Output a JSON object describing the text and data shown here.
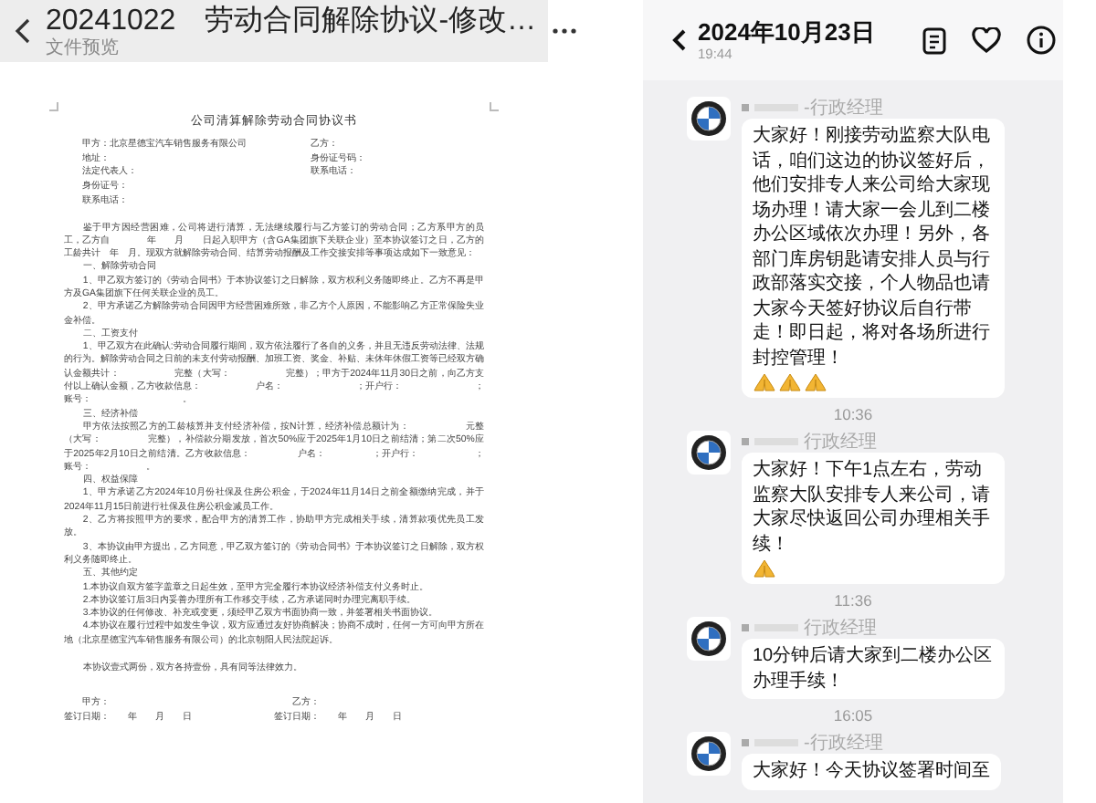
{
  "left": {
    "header": {
      "title": "20241022　劳动合同解除协议-修改…",
      "subtitle": "文件预览"
    },
    "document": {
      "title": "公司清算解除劳动合同协议书",
      "parties": [
        {
          "left": "甲方：北京星德宝汽车销售服务有限公司",
          "right": "乙方："
        },
        {
          "left": "地址：",
          "right": "身份证号码："
        },
        {
          "left": "法定代表人：",
          "right": "联系电话："
        },
        {
          "left": "身份证号："
        },
        {
          "left": "联系电话："
        }
      ],
      "blocks": [
        {
          "kind": "para",
          "text": "鉴于甲方因经营困难，公司将进行清算，无法继续履行与乙方签订的劳动合同；乙方系甲方的员工，乙方自　　　　年　　月　　日起入职甲方（含GA集团旗下关联企业）至本协议签订之日，乙方的工龄共计　年　月。现双方就解除劳动合同、结算劳动报酬及工作交接安排等事项达成如下一致意见："
        },
        {
          "kind": "heading",
          "text": "一、解除劳动合同"
        },
        {
          "kind": "para",
          "text": "1、甲乙双方签订的《劳动合同书》于本协议签订之日解除，双方权利义务随即终止。乙方不再是甲方及GA集团旗下任何关联企业的员工。"
        },
        {
          "kind": "para",
          "text": "2、甲方承诺乙方解除劳动合同因甲方经营困难所致，非乙方个人原因，不能影响乙方正常保险失业金补偿。"
        },
        {
          "kind": "heading",
          "text": "二、工资支付"
        },
        {
          "kind": "para",
          "text": "1、甲乙双方在此确认:劳动合同履行期间，双方依法履行了各自的义务，并且无违反劳动法律、法规的行为。解除劳动合同之日前的未支付劳动报酬、加班工资、奖金、补贴、未休年休假工资等已经双方确认金额共计：　　　　　　完整（大写：　　　　　　完整）；甲方于2024年11月30日之前，向乙方支付以上确认金额，乙方收款信息：　　　　　　户名：　　　　　　　　；开户行：　　　　　　　　；账号：　　　　　　　　　　。"
        },
        {
          "kind": "heading",
          "text": "三、经济补偿"
        },
        {
          "kind": "para",
          "text": "甲方依法按照乙方的工龄核算并支付经济补偿，按N计算，经济补偿总额计为：　　　　　　元整（大写：　　　　　完整），补偿款分期发放，首次50%应于2025年1月10日之前结清；第二次50%应于2025年2月10日之前结清。乙方收款信息：　　　　　户名：　　　　　；开户行：　　　　　　；账号：　　　　　　。"
        },
        {
          "kind": "heading",
          "text": "四、权益保障"
        },
        {
          "kind": "para",
          "text": "1、甲方承诺乙方2024年10月份社保及住房公积金，于2024年11月14日之前全额缴纳完成，并于2024年11月15日前进行社保及住房公积金减员工作。"
        },
        {
          "kind": "para",
          "text": "2、乙方将按照甲方的要求，配合甲方的清算工作，协助甲方完成相关手续，清算款项优先员工发放。"
        },
        {
          "kind": "para",
          "text": "3、本协议由甲方提出，乙方同意，甲乙双方签订的《劳动合同书》于本协议签订之日解除，双方权利义务随即终止。"
        },
        {
          "kind": "heading",
          "text": "五、其他约定"
        },
        {
          "kind": "para",
          "text": "1.本协议自双方签字盖章之日起生效，至甲方完全履行本协议经济补偿支付义务时止。"
        },
        {
          "kind": "para",
          "text": "2.本协议签订后3日内妥善办理所有工作移交手续，乙方承诺同时办理完离职手续。"
        },
        {
          "kind": "para",
          "text": "3.本协议的任何修改、补充或变更，须经甲乙双方书面协商一致，并签署相关书面协议。"
        },
        {
          "kind": "para",
          "text": "4.本协议在履行过程中如发生争议，双方应通过友好协商解决；协商不成时，任何一方可向甲方所在地（北京星德宝汽车销售服务有限公司）的北京朝阳人民法院起诉。"
        },
        {
          "kind": "closing",
          "text": "本协议壹式两份，双方各持壹份，具有同等法律效力。"
        }
      ],
      "signatures": [
        {
          "party": "甲方：",
          "date": "签订日期：　　年　　月　　日"
        },
        {
          "party": "乙方：",
          "date": "签订日期：　　年　　月　　日"
        }
      ]
    }
  },
  "chat": {
    "title": "2024年10月23日",
    "time": "19:44",
    "items": [
      {
        "kind": "message",
        "sender": "-行政经理",
        "text": "大家好！刚接劳动监察大队电话，咱们这边的协议签好后，他们安排专人来公司给大家现场办理！请大家一会儿到二楼办公区域依次办理！另外，各部门库房钥匙请安排人员与行政部落实交接，个人物品也请大家今天签好协议后自行带走！即日起，将对各场所进行封控管理！",
        "icons": [
          {
            "kind": "praying-hands"
          },
          {
            "kind": "praying-hands"
          },
          {
            "kind": "praying-hands"
          }
        ]
      },
      {
        "kind": "time",
        "text": "10:36"
      },
      {
        "kind": "message",
        "sender": "行政经理",
        "text": "大家好！下午1点左右，劳动监察大队安排专人来公司，请大家尽快返回公司办理相关手续！",
        "icons": [
          {
            "kind": "praying-hands"
          }
        ]
      },
      {
        "kind": "time",
        "text": "11:36"
      },
      {
        "kind": "message",
        "sender": "行政经理",
        "text": "10分钟后请大家到二楼办公区办理手续！"
      },
      {
        "kind": "time",
        "text": "16:05"
      },
      {
        "kind": "message",
        "sender": "-行政经理",
        "text": "大家好！今天协议签署时间至"
      }
    ]
  }
}
